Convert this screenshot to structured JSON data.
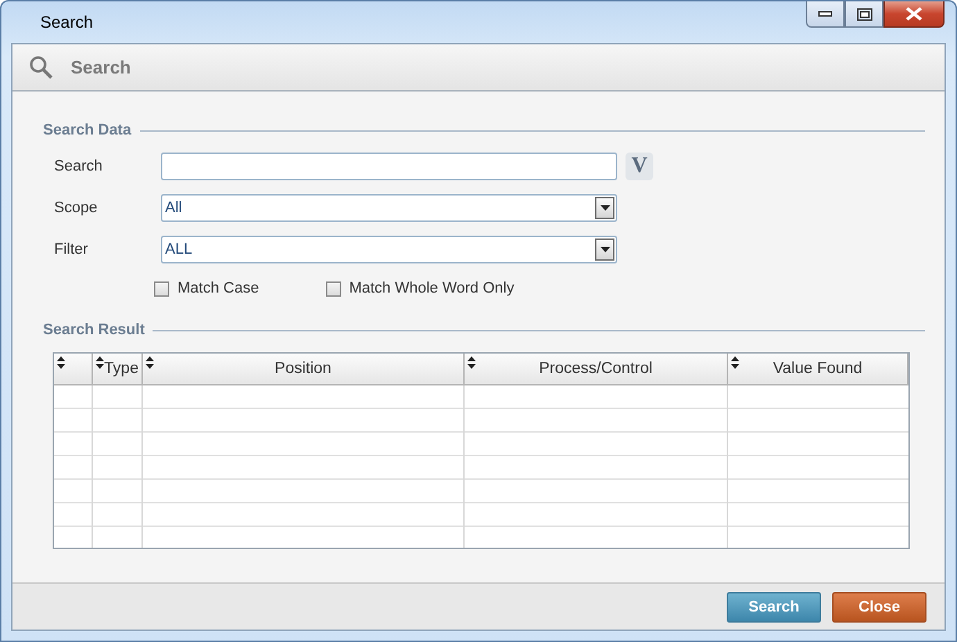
{
  "window": {
    "title": "Search"
  },
  "header": {
    "title": "Search"
  },
  "search_data": {
    "legend": "Search Data",
    "fields": [
      {
        "kind": "text",
        "label": "Search"
      },
      {
        "kind": "combo",
        "label": "Scope",
        "value": "All"
      },
      {
        "kind": "combo",
        "label": "Filter",
        "value": "ALL"
      }
    ],
    "options": [
      {
        "label": "Match Case",
        "checked": false
      },
      {
        "label": "Match Whole Word Only",
        "checked": false
      }
    ],
    "v_button": "V"
  },
  "search_result": {
    "legend": "Search Result",
    "columns": [
      {
        "label": "Type"
      },
      {
        "label": "Position"
      },
      {
        "label": "Process/Control"
      },
      {
        "label": "Value Found"
      }
    ]
  },
  "buttons": [
    {
      "kind": "primary",
      "label": "Search"
    },
    {
      "kind": "danger",
      "label": "Close"
    }
  ]
}
